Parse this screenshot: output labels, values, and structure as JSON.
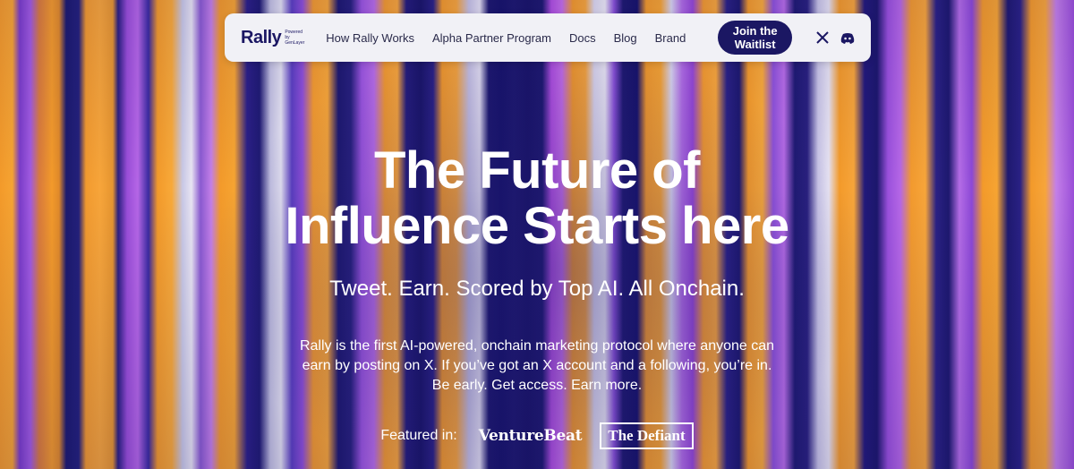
{
  "nav": {
    "logo": "Rally",
    "logo_sub_1": "Powered by",
    "logo_sub_2": "GenLayer",
    "links": [
      "How Rally Works",
      "Alpha Partner Program",
      "Docs",
      "Blog",
      "Brand"
    ],
    "cta": "Join the Waitlist",
    "social_icons": [
      "x-icon",
      "discord-icon"
    ]
  },
  "hero": {
    "title_line1": "The Future of",
    "title_line2": "Influence Starts here",
    "subtitle": "Tweet. Earn. Scored by Top AI. All Onchain.",
    "desc_line1": "Rally is the first AI-powered, onchain marketing protocol where anyone can",
    "desc_line2": "earn by posting on X. If you’ve got an X account and a following, you’re in.",
    "desc_line3": "Be early. Get access. Earn more."
  },
  "featured": {
    "label": "Featured in:",
    "outlets": [
      "VentureBeat",
      "The Defiant"
    ]
  },
  "colors": {
    "navy": "#1b1763",
    "orange": "#f39a2a",
    "purple": "#9a4ed8"
  }
}
